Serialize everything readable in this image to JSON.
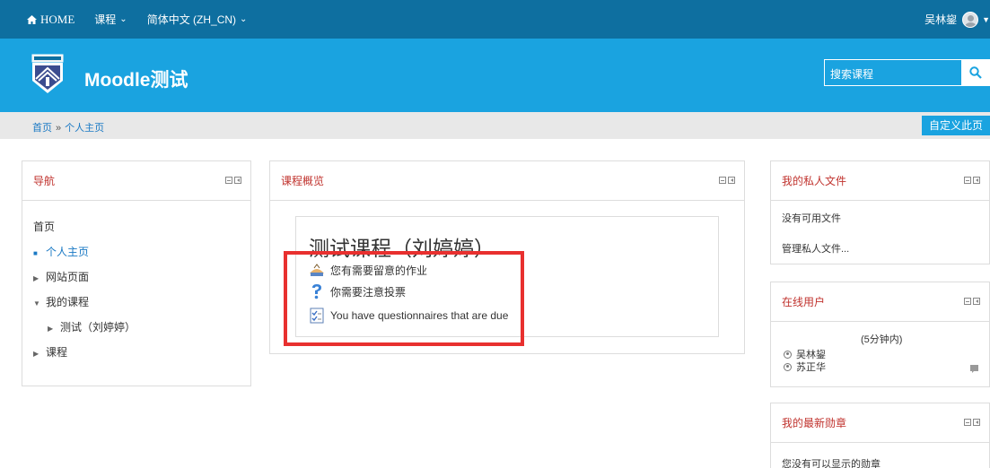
{
  "topbar": {
    "home": "HOME",
    "courses": "课程",
    "language": "简体中文 (ZH_CN)",
    "username": "吴林鋆"
  },
  "header": {
    "sitename": "Moodle测试",
    "search_placeholder": "搜索课程"
  },
  "breadcrumb": {
    "items": [
      "首页",
      "个人主页"
    ],
    "separator": "»",
    "customize_button": "自定义此页"
  },
  "navigation": {
    "title": "导航",
    "items": [
      {
        "label": "首页",
        "marker": ""
      },
      {
        "label": "个人主页",
        "marker": "■"
      },
      {
        "label": "网站页面",
        "marker": "▶"
      },
      {
        "label": "我的课程",
        "marker": "▼"
      },
      {
        "label": "测试（刘婷婷）",
        "marker": "▶"
      },
      {
        "label": "课程",
        "marker": "▶"
      }
    ]
  },
  "course_overview": {
    "title": "课程概览",
    "course_name": "测试课程（刘婷婷）",
    "alerts": [
      {
        "text": "您有需要留意的作业",
        "icon": "assignment-icon"
      },
      {
        "text": "你需要注意投票",
        "icon": "question-icon"
      },
      {
        "text": "You have questionnaires that are due",
        "icon": "questionnaire-icon"
      }
    ],
    "highlight_color": "#e8302f"
  },
  "private_files": {
    "title": "我的私人文件",
    "empty_text": "没有可用文件",
    "manage_link": "管理私人文件..."
  },
  "online_users": {
    "title": "在线用户",
    "note": "(5分钟内)",
    "users": [
      "吴林鋆",
      "苏正华"
    ]
  },
  "badges": {
    "title": "我的最新勋章",
    "empty_text": "您没有可以显示的勋章"
  },
  "colors": {
    "navbar": "#0e6fa0",
    "header": "#1aa3e0",
    "block_title": "#c0322d",
    "link": "#1a79c4"
  }
}
